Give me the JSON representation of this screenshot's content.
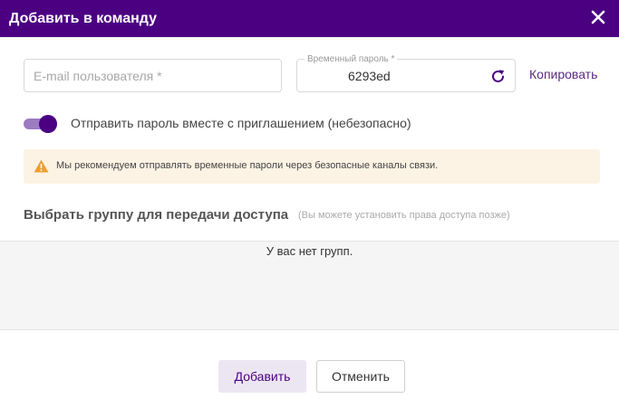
{
  "dialog": {
    "title": "Добавить в команду",
    "close_icon": "close-icon"
  },
  "form": {
    "email_placeholder": "E-mail пользователя *",
    "email_value": "",
    "password_label": "Временный пароль *",
    "password_value": "6293ed",
    "refresh_icon": "refresh-icon",
    "copy_label": "Копировать",
    "toggle_on": true,
    "toggle_label": "Отправить пароль вместе с приглашением (небезопасно)"
  },
  "warning": {
    "icon": "warning-icon",
    "text": "Мы рекомендуем отправлять временные пароли через безопасные каналы связи."
  },
  "groups": {
    "title": "Выбрать группу для передачи доступа",
    "hint": "(Вы можете установить права доступа позже)",
    "empty_text": "У вас нет групп."
  },
  "footer": {
    "add_label": "Добавить",
    "cancel_label": "Отменить"
  },
  "colors": {
    "accent": "#4b0082",
    "warning_bg": "#fdf3e4",
    "warning_icon": "#f0a030"
  }
}
